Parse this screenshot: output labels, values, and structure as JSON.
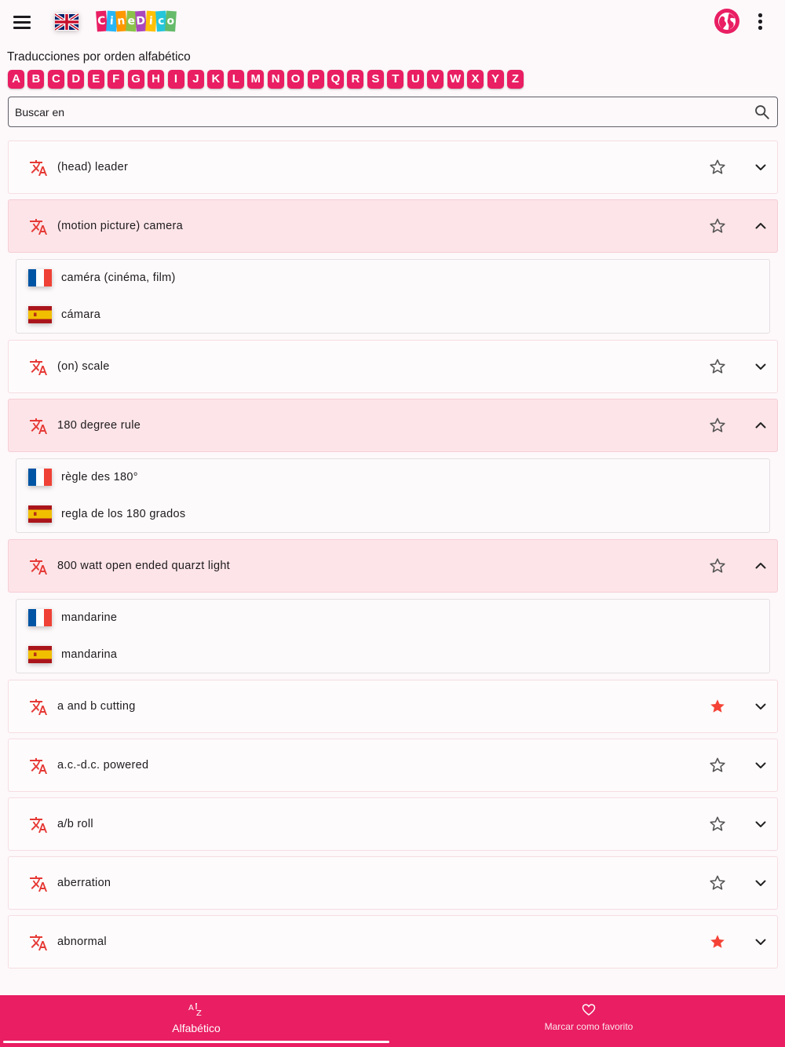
{
  "header": {
    "menu_icon": "menu-icon",
    "language_flag": "uk-flag-icon",
    "logo_text": "CineDico",
    "logo_colors": [
      "#e91e63",
      "#29b6f6",
      "#ff9800",
      "#8bc34a",
      "#ab47bc",
      "#ffc107",
      "#26c6da",
      "#66bb6a"
    ],
    "globe_icon": "globe-icon",
    "more_icon": "more-vert-icon"
  },
  "section_title": "Traducciones por orden alfabético",
  "letters": [
    "A",
    "B",
    "C",
    "D",
    "E",
    "F",
    "G",
    "H",
    "I",
    "J",
    "K",
    "L",
    "M",
    "N",
    "O",
    "P",
    "Q",
    "R",
    "S",
    "T",
    "U",
    "V",
    "W",
    "X",
    "Y",
    "Z"
  ],
  "search": {
    "placeholder": "Buscar en",
    "value": "",
    "icon": "search-icon"
  },
  "colors": {
    "accent": "#e91e63",
    "expanded_bg": "#fde4e8",
    "star_filled": "#f44336"
  },
  "entries": [
    {
      "term": "(head) leader",
      "favorite": false,
      "expanded": false,
      "translations": []
    },
    {
      "term": "(motion picture) camera",
      "favorite": false,
      "expanded": true,
      "translations": [
        {
          "lang": "fr",
          "text": "caméra (cinéma, film)"
        },
        {
          "lang": "es",
          "text": "cámara"
        }
      ]
    },
    {
      "term": "(on) scale",
      "favorite": false,
      "expanded": false,
      "translations": []
    },
    {
      "term": "180 degree rule",
      "favorite": false,
      "expanded": true,
      "translations": [
        {
          "lang": "fr",
          "text": "règle des 180°"
        },
        {
          "lang": "es",
          "text": "regla de los 180 grados"
        }
      ]
    },
    {
      "term": "800 watt open ended quarzt light",
      "favorite": false,
      "expanded": true,
      "translations": [
        {
          "lang": "fr",
          "text": "mandarine"
        },
        {
          "lang": "es",
          "text": "mandarina"
        }
      ]
    },
    {
      "term": "a and b cutting",
      "favorite": true,
      "expanded": false,
      "translations": []
    },
    {
      "term": "a.c.-d.c. powered",
      "favorite": false,
      "expanded": false,
      "translations": []
    },
    {
      "term": "a/b roll",
      "favorite": false,
      "expanded": false,
      "translations": []
    },
    {
      "term": "aberration",
      "favorite": false,
      "expanded": false,
      "translations": []
    },
    {
      "term": "abnormal",
      "favorite": true,
      "expanded": false,
      "translations": []
    }
  ],
  "bottom_nav": {
    "tabs": [
      {
        "label": "Alfabético",
        "icon": "sort-az-icon",
        "active": true
      },
      {
        "label": "Marcar como favorito",
        "icon": "heart-icon",
        "active": false
      }
    ]
  }
}
